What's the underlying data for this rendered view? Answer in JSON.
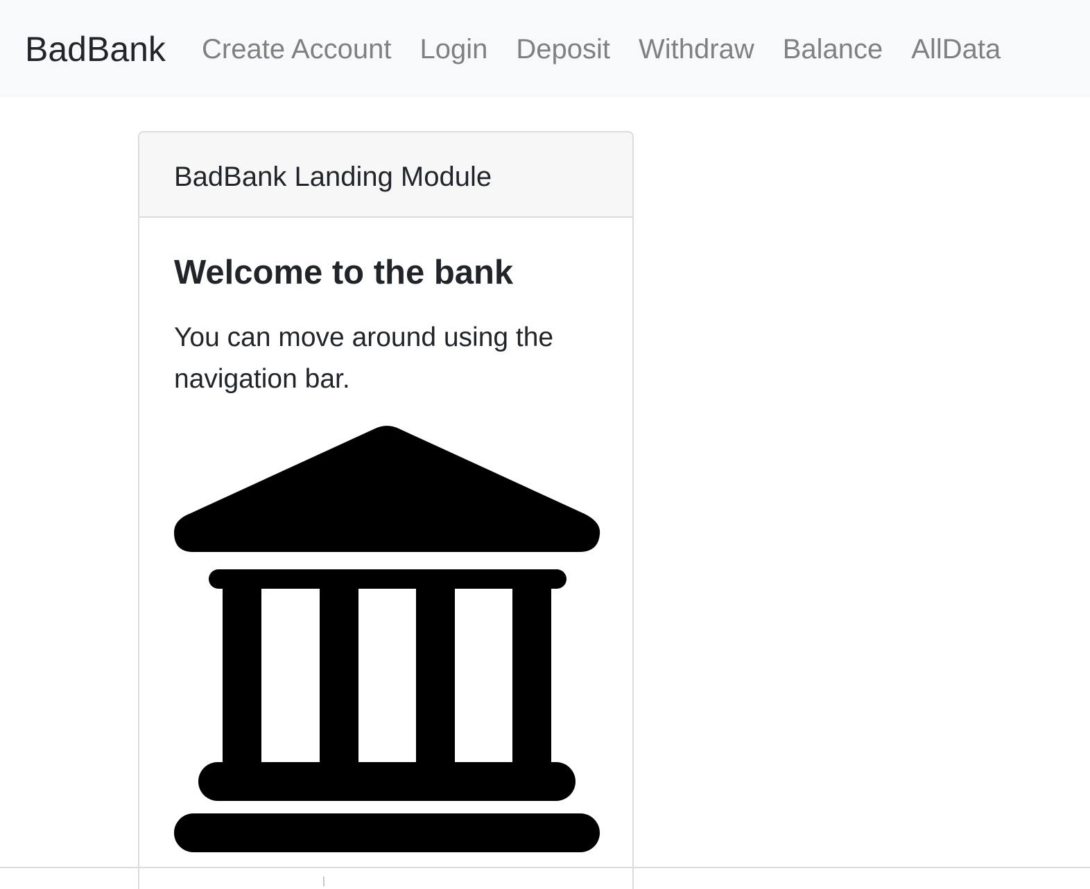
{
  "navbar": {
    "brand": "BadBank",
    "links": [
      {
        "label": "Create Account"
      },
      {
        "label": "Login"
      },
      {
        "label": "Deposit"
      },
      {
        "label": "Withdraw"
      },
      {
        "label": "Balance"
      },
      {
        "label": "AllData"
      }
    ]
  },
  "card": {
    "header": "BadBank Landing Module",
    "title": "Welcome to the bank",
    "text": "You can move around using the navigation bar.",
    "image_icon": "bank-icon"
  },
  "colors": {
    "navbar_bg": "#f8f9fa",
    "nav_link": "#808080",
    "text": "#212529",
    "card_header_bg": "#f7f7f7"
  }
}
